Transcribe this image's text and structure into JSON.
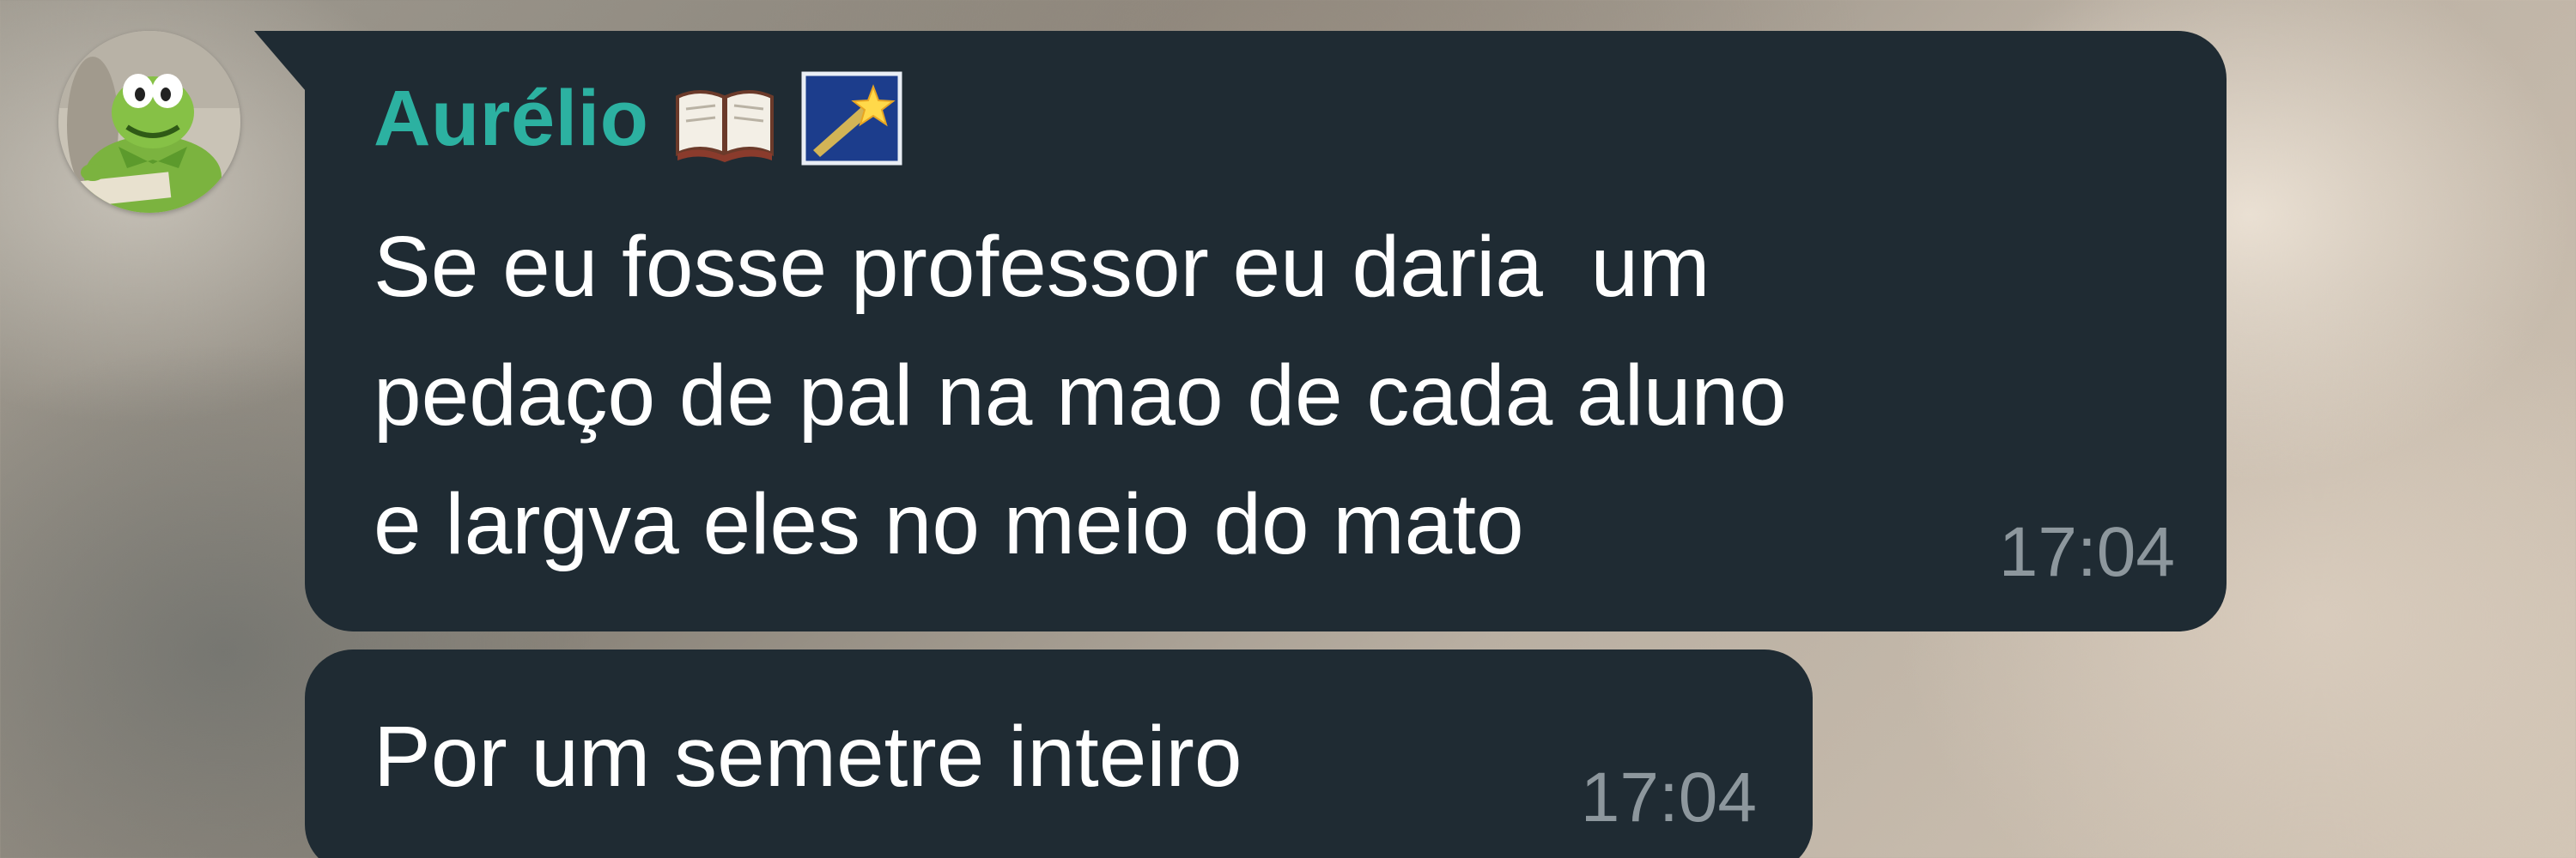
{
  "chat": {
    "sender": {
      "name": "Aurélio",
      "emoji_icons": [
        "open-book-icon",
        "shooting-star-icon"
      ],
      "name_color": "#2cb1a1",
      "avatar_icon": "kermit-avatar"
    },
    "messages": [
      {
        "lines": [
          "Se eu fosse professor eu daria  um",
          "pedaço de pal na mao de cada aluno",
          "e largva eles no meio do mato"
        ],
        "time": "17:04"
      },
      {
        "lines": [
          "Por um semetre inteiro"
        ],
        "time": "17:04"
      }
    ]
  },
  "colors": {
    "bubble": "#1f2b33",
    "text": "#ffffff",
    "timestamp": "#8d979d"
  }
}
